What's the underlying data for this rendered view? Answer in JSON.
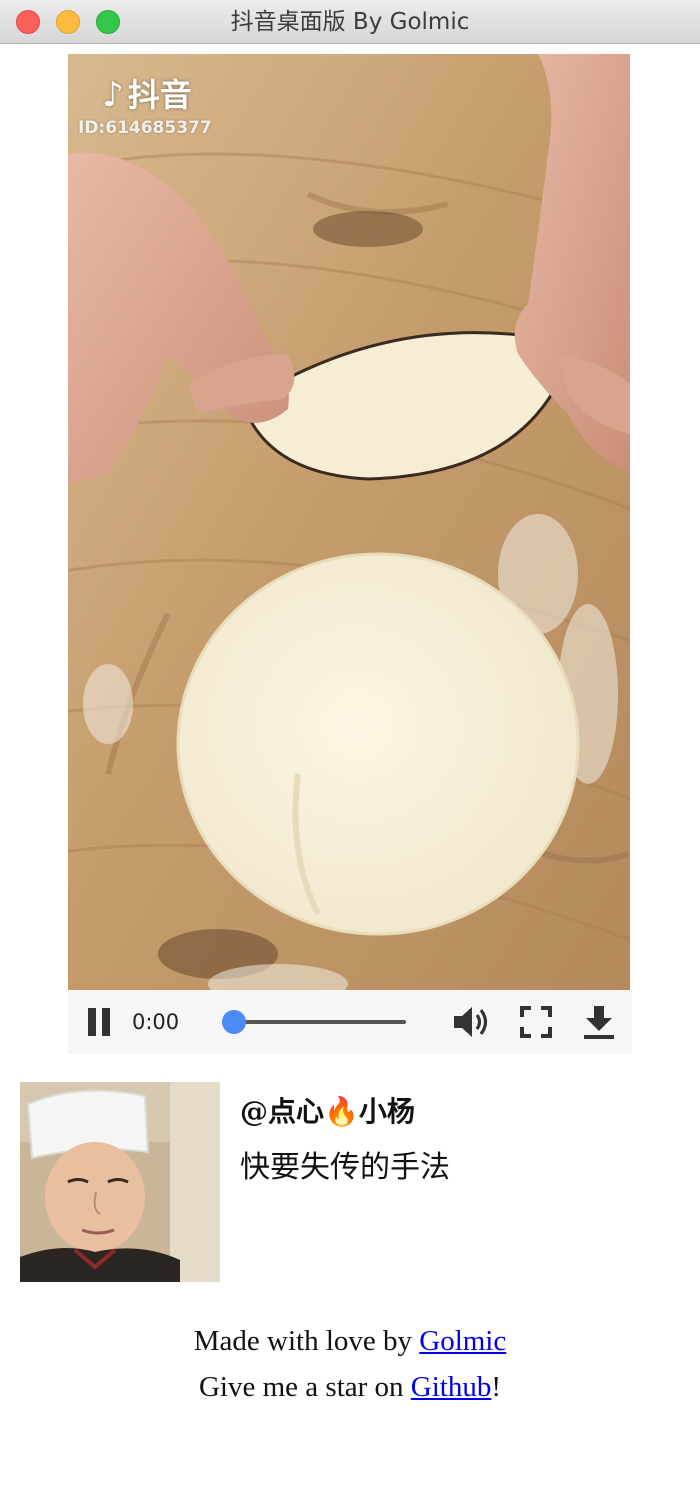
{
  "window": {
    "title": "抖音桌面版 By Golmic"
  },
  "video": {
    "watermark_brand": "抖音",
    "watermark_id": "ID:614685377"
  },
  "player": {
    "current_time": "0:00",
    "progress_fraction": 0.0,
    "playing": true,
    "icons": [
      "pause-icon",
      "volume-icon",
      "fullscreen-icon",
      "download-icon"
    ]
  },
  "author": {
    "handle_prefix": "@点心",
    "handle_emoji": "🔥",
    "handle_suffix": "小杨",
    "description": "快要失传的手法"
  },
  "footer": {
    "line1_text": "Made with love by ",
    "line1_link": "Golmic",
    "line2_text": "Give me a star on ",
    "line2_link": "Github",
    "line2_end": "!"
  },
  "colors": {
    "accent": "#4c8bf5",
    "link": "#0000ee",
    "close": "#fc605b",
    "minimize": "#fdbc40",
    "zoom": "#34c84a"
  }
}
